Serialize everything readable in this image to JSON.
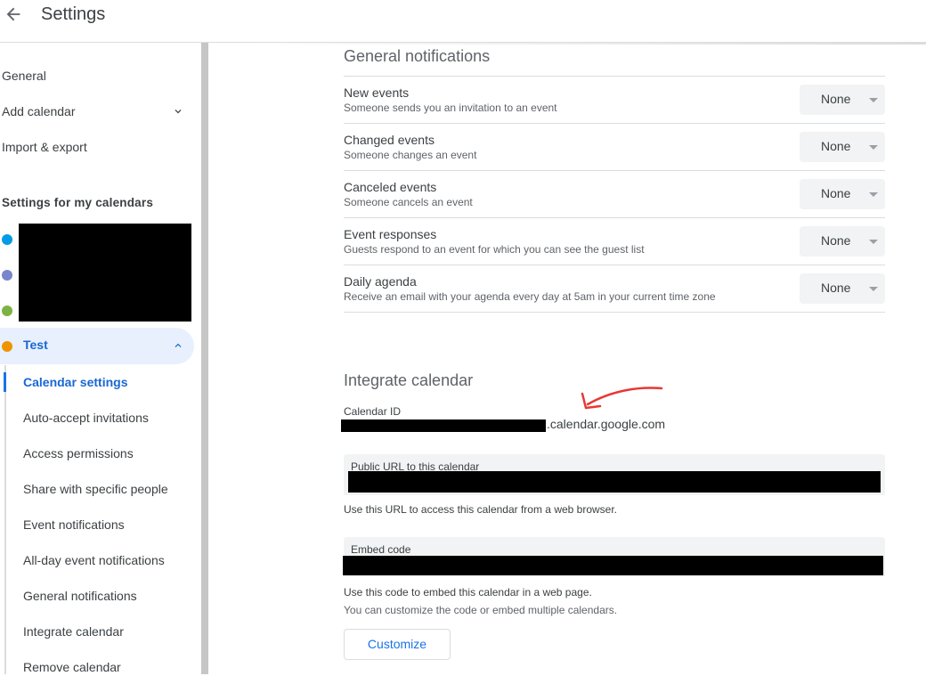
{
  "header": {
    "title": "Settings"
  },
  "sidebar": {
    "items": [
      {
        "label": "General"
      },
      {
        "label": "Add calendar"
      },
      {
        "label": "Import & export"
      }
    ],
    "section_heading": "Settings for my calendars",
    "calendar_dot_colors": [
      "#039be5",
      "#7986cb",
      "#7cb342",
      "#f09300"
    ],
    "active_calendar": {
      "label": "Test",
      "color": "#f09300"
    },
    "sub_items": [
      {
        "label": "Calendar settings"
      },
      {
        "label": "Auto-accept invitations"
      },
      {
        "label": "Access permissions"
      },
      {
        "label": "Share with specific people"
      },
      {
        "label": "Event notifications"
      },
      {
        "label": "All-day event notifications"
      },
      {
        "label": "General notifications"
      },
      {
        "label": "Integrate calendar"
      },
      {
        "label": "Remove calendar"
      }
    ]
  },
  "general_notifications": {
    "heading": "General notifications",
    "rows": [
      {
        "title": "New events",
        "desc": "Someone sends you an invitation to an event",
        "value": "None"
      },
      {
        "title": "Changed events",
        "desc": "Someone changes an event",
        "value": "None"
      },
      {
        "title": "Canceled events",
        "desc": "Someone cancels an event",
        "value": "None"
      },
      {
        "title": "Event responses",
        "desc": "Guests respond to an event for which you can see the guest list",
        "value": "None"
      },
      {
        "title": "Daily agenda",
        "desc": "Receive an email with your agenda every day at 5am in your current time zone",
        "value": "None"
      }
    ]
  },
  "integrate": {
    "heading": "Integrate calendar",
    "calendar_id_label": "Calendar ID",
    "calendar_id_suffix": ".calendar.google.com",
    "public_url_label": "Public URL to this calendar",
    "public_url_help": "Use this URL to access this calendar from a web browser.",
    "embed_label": "Embed code",
    "embed_help": "Use this code to embed this calendar in a web page.",
    "embed_help2": "You can customize the code or embed multiple calendars.",
    "customize_label": "Customize"
  },
  "colors": {
    "accent": "#1a73e8",
    "annotation": "#e53935"
  }
}
